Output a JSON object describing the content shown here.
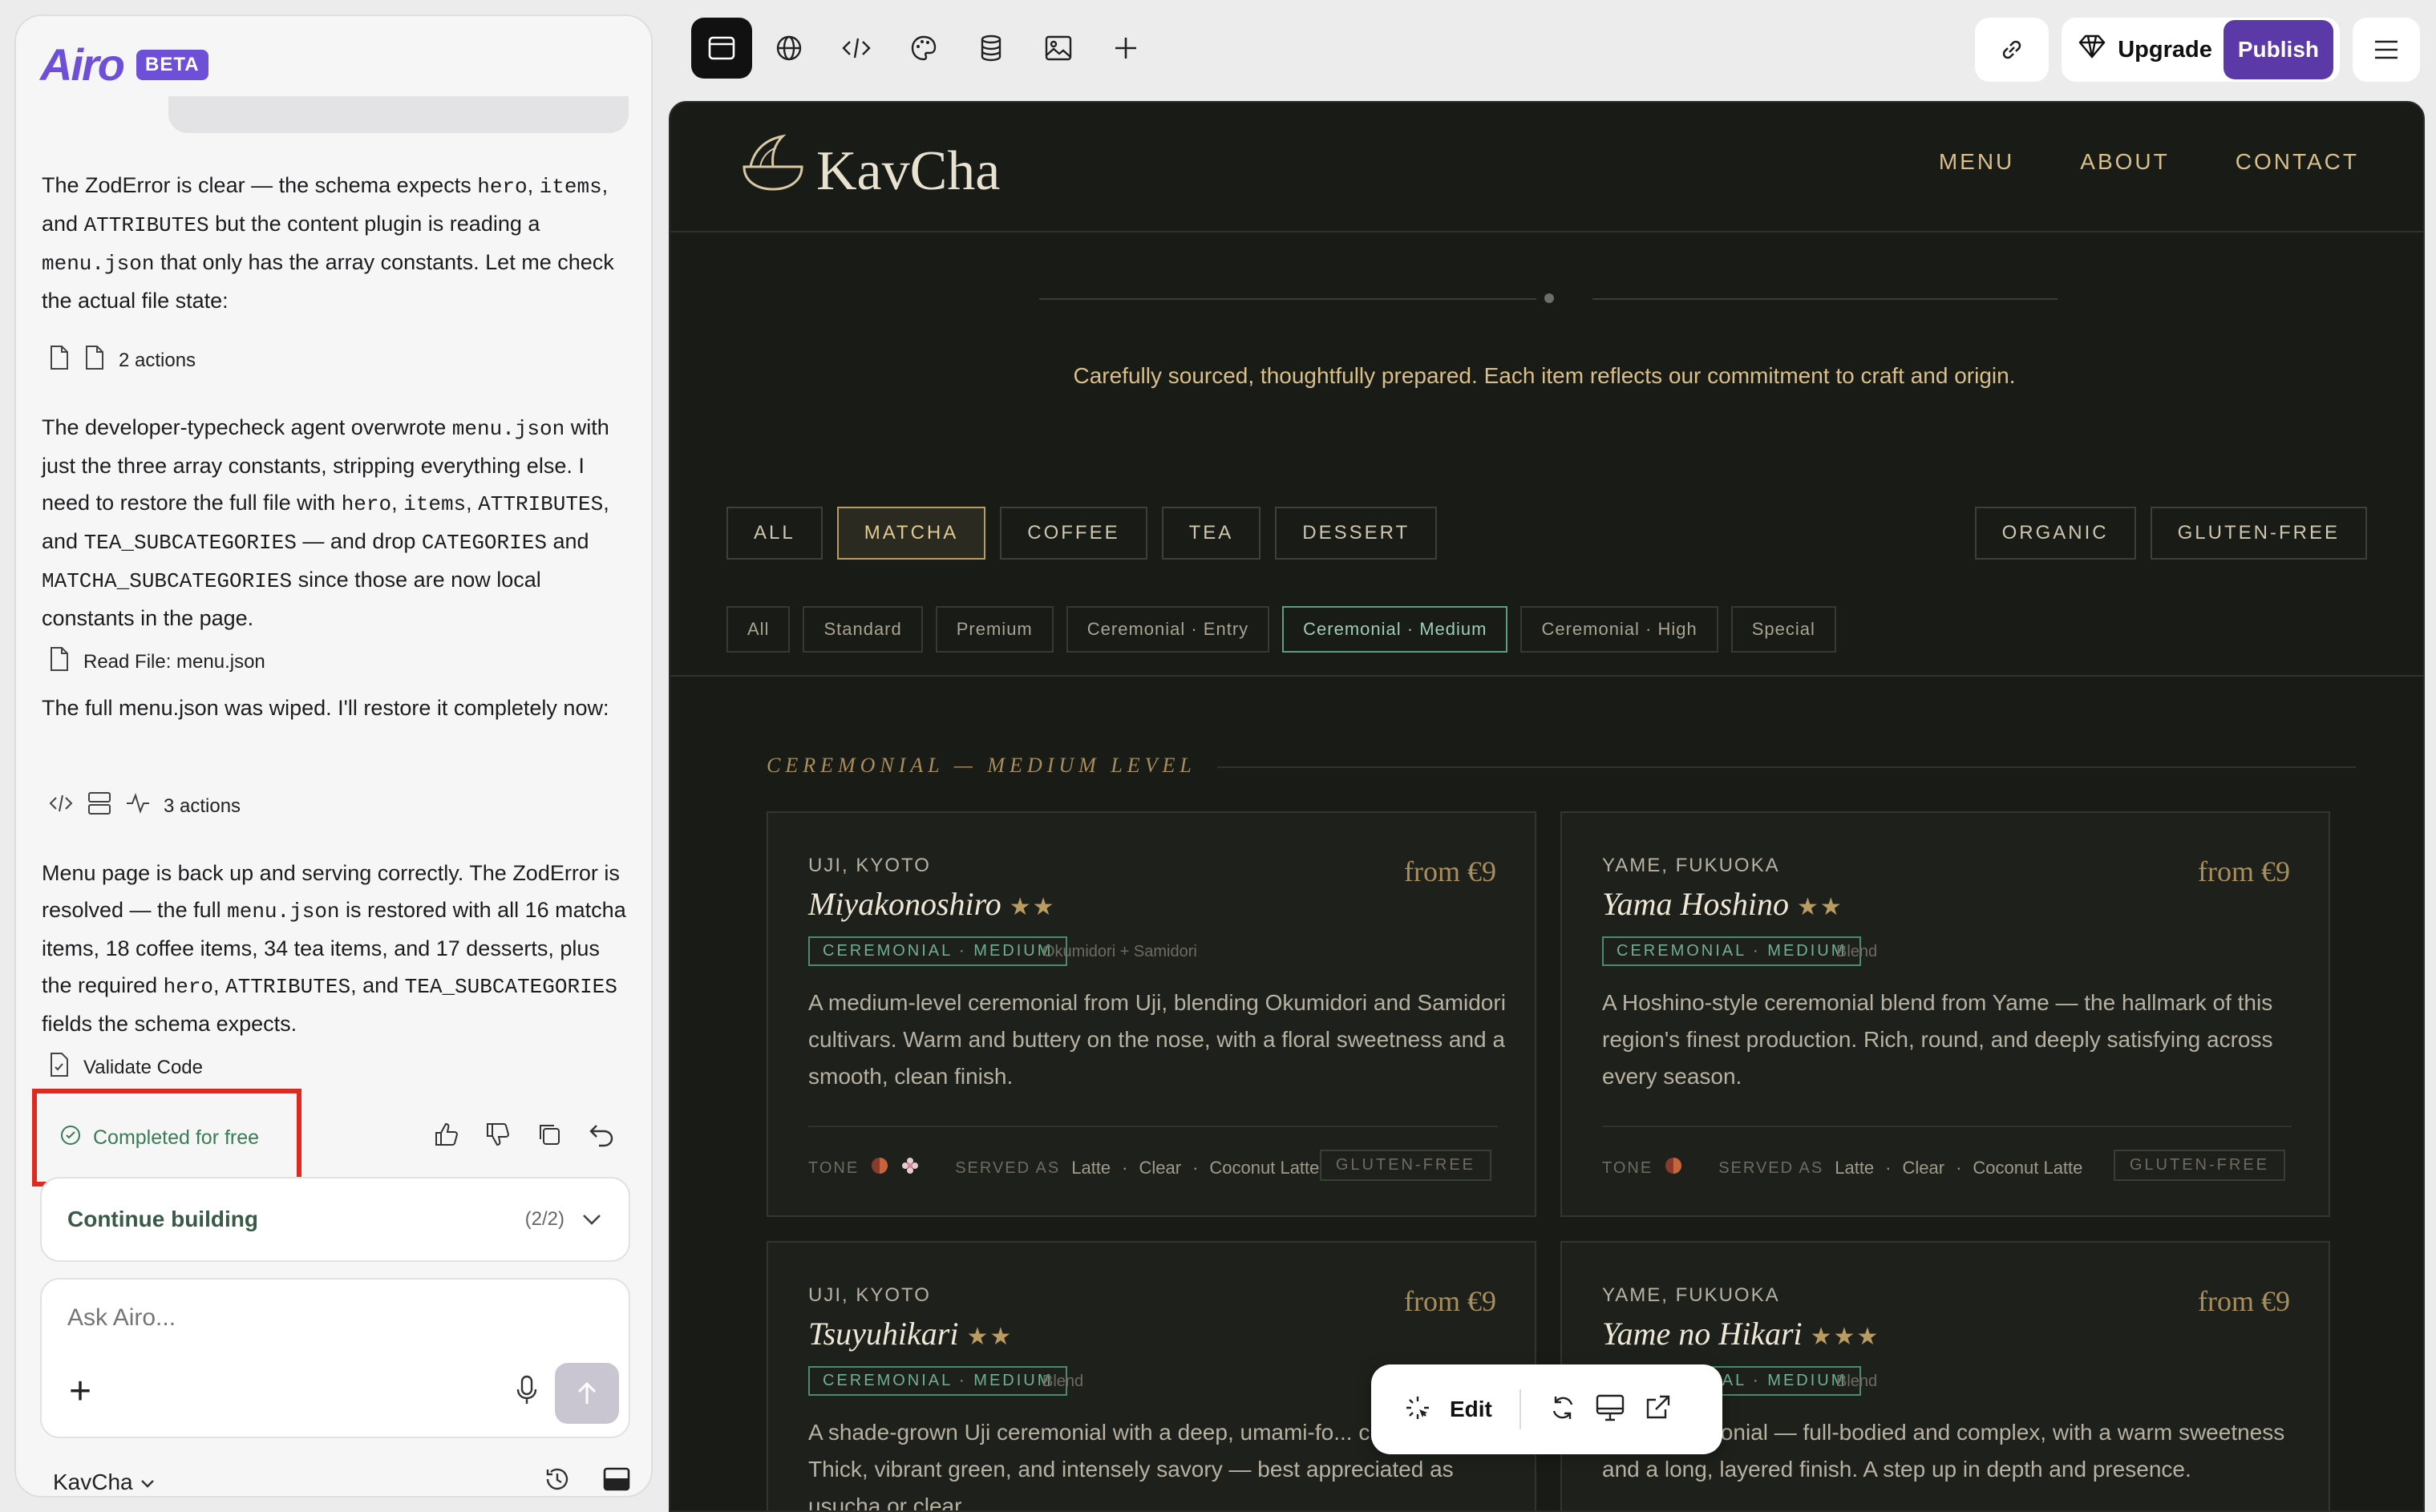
{
  "chat": {
    "brand": "Airo",
    "beta": "BETA",
    "msg1": {
      "a": "The ZodError is clear — the schema expects ",
      "c1": "hero",
      "b": ", ",
      "c2": "items",
      "d": ", and ",
      "c3": "ATTRIBUTES",
      "e": " but the content plugin is reading a ",
      "c4": "menu.json",
      "f": " that only has the array constants. Let me check the actual file state:"
    },
    "actions1": "2 actions",
    "msg2": {
      "a": "The developer-typecheck agent overwrote ",
      "c1": "menu.json",
      "b": " with just the three array constants, stripping everything else. I need to restore the full file with ",
      "c2": "hero",
      "c": ", ",
      "c3": "items",
      "d": ", ",
      "c4": "ATTRIBUTES",
      "e": ", and ",
      "c5": "TEA_SUBCATEGORIES",
      "f": " — and drop ",
      "c6": "CATEGORIES",
      "g": " and ",
      "c7": "MATCHA_SUBCATEGORIES",
      "h": " since those are now local constants in the page."
    },
    "read_file": "Read File: menu.json",
    "msg3": "The full menu.json was wiped. I'll restore it completely now:",
    "actions2": "3 actions",
    "msg4": {
      "a": "Menu page is back up and serving correctly. The ZodError is resolved — the full ",
      "c1": "menu.json",
      "b": " is restored with all 16 matcha items, 18 coffee items, 34 tea items, and 17 desserts, plus the required ",
      "c2": "hero",
      "c": ", ",
      "c3": "ATTRIBUTES",
      "d": ", and ",
      "c4": "TEA_SUBCATEGORIES",
      "e": " fields the schema expects."
    },
    "validate": "Validate Code",
    "status": "Completed for free",
    "continue_label": "Continue building",
    "continue_count": "(2/2)",
    "ask_placeholder": "Ask Airo...",
    "project": "KavCha"
  },
  "toolbar": {
    "upgrade": "Upgrade",
    "publish": "Publish"
  },
  "site": {
    "logo": "KavCha",
    "nav": [
      "MENU",
      "ABOUT",
      "CONTACT"
    ],
    "tagline": "Carefully sourced, thoughtfully prepared. Each item reflects our commitment to craft and origin.",
    "categories": [
      "ALL",
      "MATCHA",
      "COFFEE",
      "TEA",
      "DESSERT"
    ],
    "active_category": "MATCHA",
    "attributes": [
      "ORGANIC",
      "GLUTEN-FREE"
    ],
    "subcategories": [
      "All",
      "Standard",
      "Premium",
      "Ceremonial · Entry",
      "Ceremonial · Medium",
      "Ceremonial · High",
      "Special"
    ],
    "active_subcategory": "Ceremonial · Medium",
    "section_title": "CEREMONIAL — MEDIUM LEVEL",
    "tone_label": "TONE",
    "served_label": "SERVED AS",
    "cards": [
      {
        "origin": "UJI, KYOTO",
        "price": "from €9",
        "name": "Miyakonoshiro",
        "stars": "★★",
        "badge": "CEREMONIAL · MEDIUM",
        "cultivar": "Okumidori + Samidori",
        "desc": "A medium-level ceremonial from Uji, blending Okumidori and Samidori cultivars. Warm and buttery on the nose, with a floral sweetness and a smooth, clean finish.",
        "served": [
          "Latte",
          "Clear",
          "Coconut Latte"
        ],
        "tag": "GLUTEN-FREE"
      },
      {
        "origin": "YAME, FUKUOKA",
        "price": "from €9",
        "name": "Yama Hoshino",
        "stars": "★★",
        "badge": "CEREMONIAL · MEDIUM",
        "cultivar": "Blend",
        "desc": "A Hoshino-style ceremonial blend from Yame — the hallmark of this region's finest production. Rich, round, and deeply satisfying across every season.",
        "served": [
          "Latte",
          "Clear",
          "Coconut Latte"
        ],
        "tag": "GLUTEN-FREE"
      },
      {
        "origin": "UJI, KYOTO",
        "price": "from €9",
        "name": "Tsuyuhikari",
        "stars": "★★",
        "badge": "CEREMONIAL · MEDIUM",
        "cultivar": "Blend",
        "desc": "A shade-grown Uji ceremonial with a deep, umami-fo... character. Thick, vibrant green, and intensely savory — best appreciated as usucha or clear."
      },
      {
        "origin": "YAME, FUKUOKA",
        "price": "from €9",
        "name": "Yame no Hikari",
        "stars": "★★★",
        "badge": "CEREMONIAL · MEDIUM",
        "cultivar": "Blend",
        "desc": "...me ceremonial — full-bodied and complex, with a warm sweetness and a long, layered finish. A step up in depth and presence."
      }
    ]
  },
  "floatbar": {
    "edit": "Edit"
  }
}
